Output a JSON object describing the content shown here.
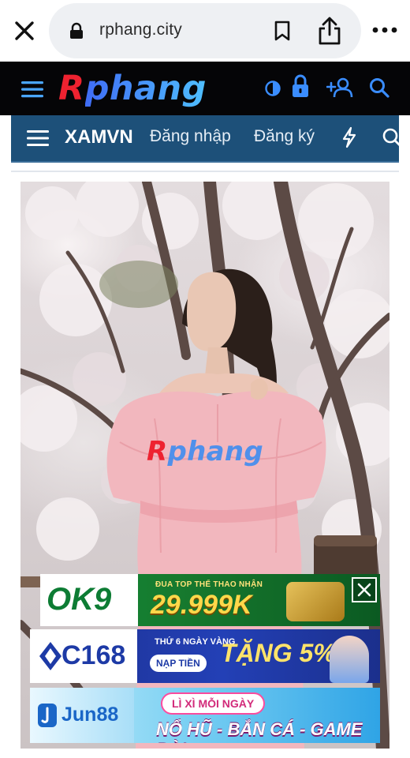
{
  "browser": {
    "url": "rphang.city"
  },
  "site_header": {
    "logo_first": "R",
    "logo_rest": "phang"
  },
  "sub_nav": {
    "brand": "XAMVN",
    "login": "Đăng nhập",
    "register": "Đăng ký"
  },
  "content": {
    "watermark_first": "R",
    "watermark_rest": "phang"
  },
  "ads": [
    {
      "brand": "OK9",
      "tagline": "ĐUA TOP THỂ THAO NHẬN",
      "amount": "29.999K"
    },
    {
      "brand": "C168",
      "tagline": "THỨ 6 NGÀY VÀNG",
      "button": "NẠP TIỀN",
      "headline": "TẶNG 5%"
    },
    {
      "brand": "Jun88",
      "tagline": "LÌ XÌ MỖI NGÀY",
      "headline": "NỔ HŨ - BẮN CÁ - GAME BÀI"
    }
  ],
  "icons": {
    "close": "close-icon",
    "lock": "lock-icon",
    "bookmark": "bookmark-icon",
    "share": "share-icon",
    "more": "more-icon",
    "menu": "menu-icon",
    "theme": "theme-toggle-icon",
    "login": "padlock-icon",
    "add_user": "add-user-icon",
    "search": "search-icon",
    "bolt": "bolt-icon"
  },
  "colors": {
    "header_bg": "#050507",
    "subnav_bg": "#1d5079",
    "logo_red": "#ee2230",
    "logo_blue": "#3f6cf5"
  }
}
